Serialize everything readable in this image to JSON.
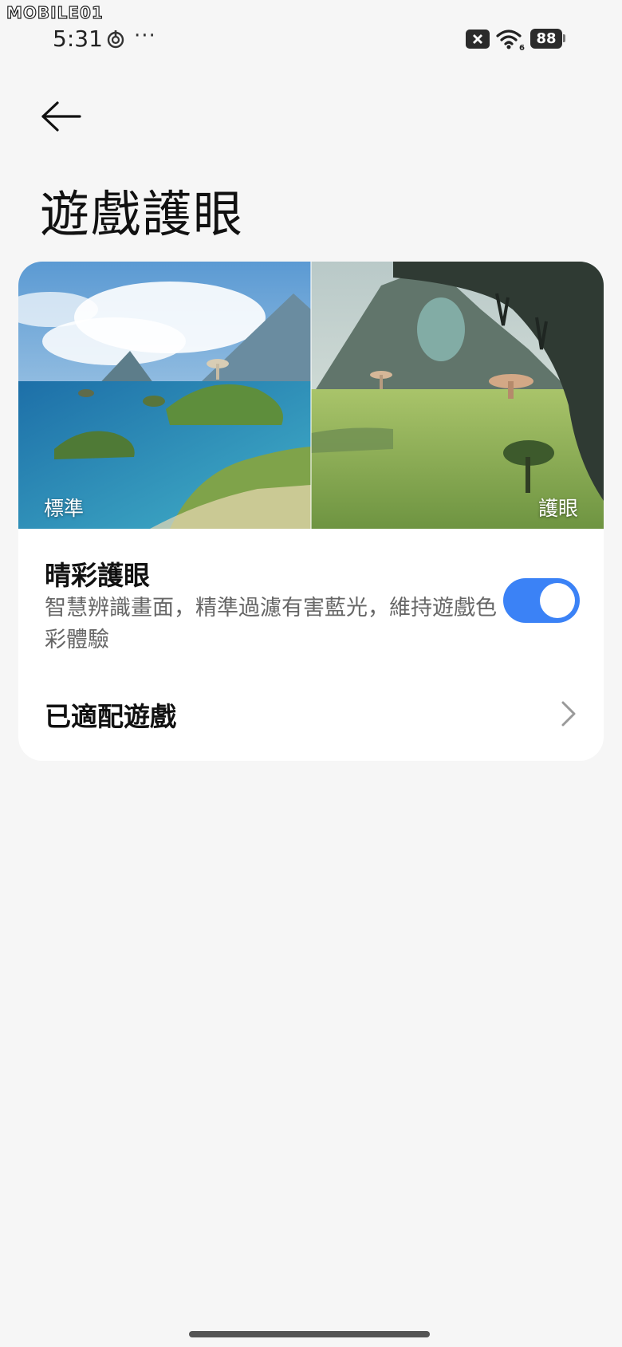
{
  "watermark": "MOBILE01",
  "status_bar": {
    "time": "5:31",
    "dots": "···",
    "wifi_sub": "6",
    "battery": "88",
    "icons": [
      "vpn-ring-icon",
      "sim-off-icon",
      "wifi-icon",
      "battery-icon"
    ]
  },
  "header": {
    "back_icon": "arrow-left-icon",
    "title": "遊戲護眼"
  },
  "preview": {
    "label_left": "標準",
    "label_right": "護眼"
  },
  "eye_care_setting": {
    "title": "晴彩護眼",
    "description": "智慧辨識畫面，精準過濾有害藍光，維持遊戲色彩體驗",
    "enabled": true
  },
  "adapted_games": {
    "label": "已適配遊戲",
    "icon": "chevron-right-icon"
  },
  "colors": {
    "background": "#f6f6f6",
    "card": "#ffffff",
    "toggle_on": "#3b82f6"
  }
}
